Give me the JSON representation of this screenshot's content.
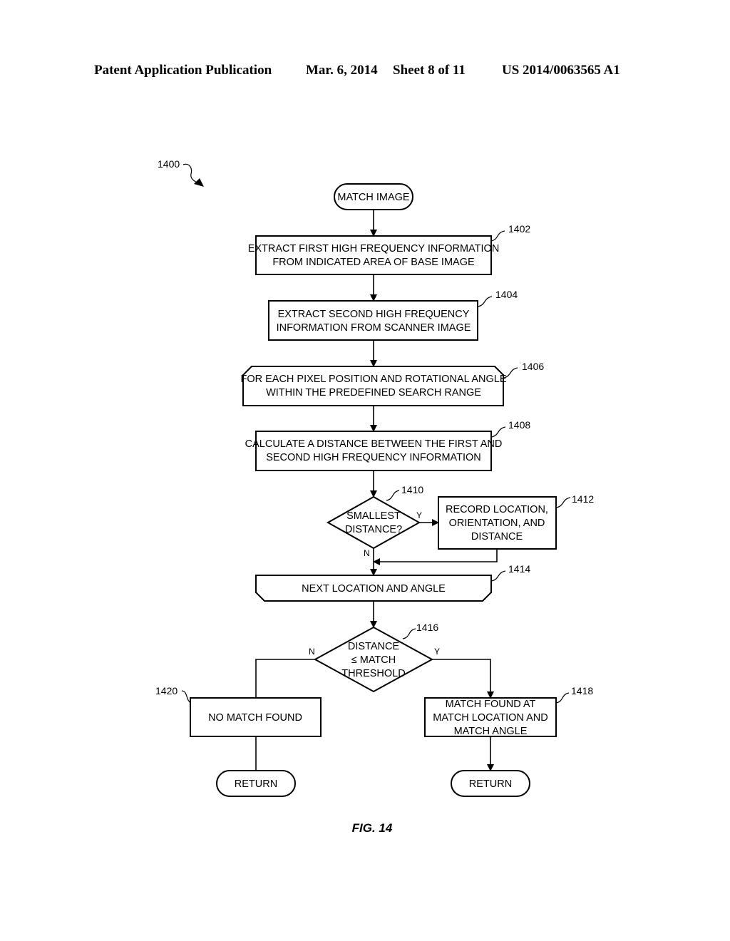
{
  "header": {
    "publication": "Patent Application Publication",
    "date": "Mar. 6, 2014",
    "sheet": "Sheet 8 of 11",
    "number": "US 2014/0063565 A1"
  },
  "figure": {
    "ref": "1400",
    "caption": "FIG. 14"
  },
  "nodes": {
    "start": {
      "type": "terminal",
      "lines": [
        "MATCH IMAGE"
      ]
    },
    "n1402": {
      "ref": "1402",
      "type": "process",
      "lines": [
        "EXTRACT FIRST HIGH FREQUENCY INFORMATION",
        "FROM INDICATED AREA OF BASE IMAGE"
      ]
    },
    "n1404": {
      "ref": "1404",
      "type": "process",
      "lines": [
        "EXTRACT SECOND HIGH FREQUENCY",
        "INFORMATION FROM SCANNER IMAGE"
      ]
    },
    "n1406": {
      "ref": "1406",
      "type": "loop-start",
      "lines": [
        "FOR EACH PIXEL POSITION AND ROTATIONAL ANGLE",
        "WITHIN THE PREDEFINED SEARCH RANGE"
      ]
    },
    "n1408": {
      "ref": "1408",
      "type": "process",
      "lines": [
        "CALCULATE A DISTANCE BETWEEN THE FIRST AND",
        "SECOND HIGH FREQUENCY INFORMATION"
      ]
    },
    "n1410": {
      "ref": "1410",
      "type": "decision",
      "lines": [
        "SMALLEST",
        "DISTANCE?"
      ],
      "yes": "Y",
      "no": "N"
    },
    "n1412": {
      "ref": "1412",
      "type": "process",
      "lines": [
        "RECORD LOCATION,",
        "ORIENTATION, AND",
        "DISTANCE"
      ]
    },
    "n1414": {
      "ref": "1414",
      "type": "loop-end",
      "lines": [
        "NEXT LOCATION AND ANGLE"
      ]
    },
    "n1416": {
      "ref": "1416",
      "type": "decision",
      "lines": [
        "DISTANCE",
        "≤ MATCH",
        "THRESHOLD"
      ],
      "yes": "Y",
      "no": "N"
    },
    "n1418": {
      "ref": "1418",
      "type": "process",
      "lines": [
        "MATCH FOUND AT",
        "MATCH LOCATION AND",
        "MATCH ANGLE"
      ]
    },
    "n1420": {
      "ref": "1420",
      "type": "process",
      "lines": [
        "NO MATCH FOUND"
      ]
    },
    "return_left": {
      "type": "terminal",
      "lines": [
        "RETURN"
      ]
    },
    "return_right": {
      "type": "terminal",
      "lines": [
        "RETURN"
      ]
    }
  }
}
